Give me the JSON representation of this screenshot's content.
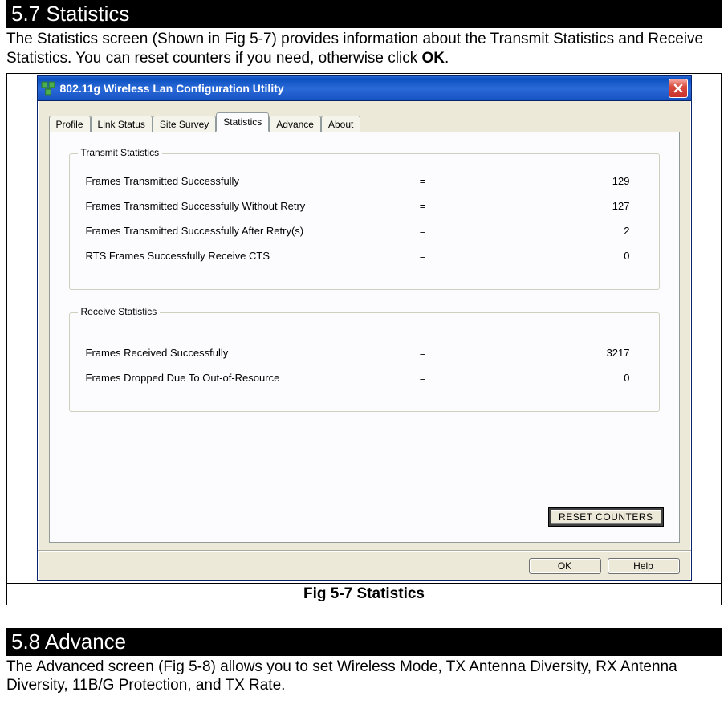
{
  "section1": {
    "heading": "5.7 Statistics",
    "body_pre": "The Statistics screen (Shown in Fig 5-7) provides information about the Transmit Statistics and Receive Statistics. You can reset counters if you need, otherwise click ",
    "body_bold": "OK",
    "body_post": "."
  },
  "dialog": {
    "title": "802.11g Wireless Lan Configuration Utility",
    "tabs": [
      "Profile",
      "Link Status",
      "Site Survey",
      "Statistics",
      "Advance",
      "About"
    ],
    "active_tab": 3,
    "transmit": {
      "legend": "Transmit Statistics",
      "rows": [
        {
          "label": "Frames Transmitted Successfully",
          "value": "129"
        },
        {
          "label": "Frames Transmitted Successfully  Without Retry",
          "value": "127"
        },
        {
          "label": "Frames Transmitted Successfully After Retry(s)",
          "value": "2"
        },
        {
          "label": "RTS Frames Successfully Receive CTS",
          "value": "0"
        }
      ]
    },
    "receive": {
      "legend": "Receive Statistics",
      "rows": [
        {
          "label": "Frames Received Successfully",
          "value": "3217"
        },
        {
          "label": "Frames Dropped Due To Out-of-Resource",
          "value": "0"
        }
      ]
    },
    "reset_label_u": "R",
    "reset_label_rest": "ESET COUNTERS",
    "ok_label": "OK",
    "help_label": "Help"
  },
  "fig_caption": "Fig 5-7 Statistics",
  "section2": {
    "heading": "5.8 Advance",
    "body": "The Advanced screen (Fig 5-8) allows you to set Wireless Mode, TX Antenna Diversity, RX Antenna Diversity, 11B/G Protection, and TX Rate."
  }
}
